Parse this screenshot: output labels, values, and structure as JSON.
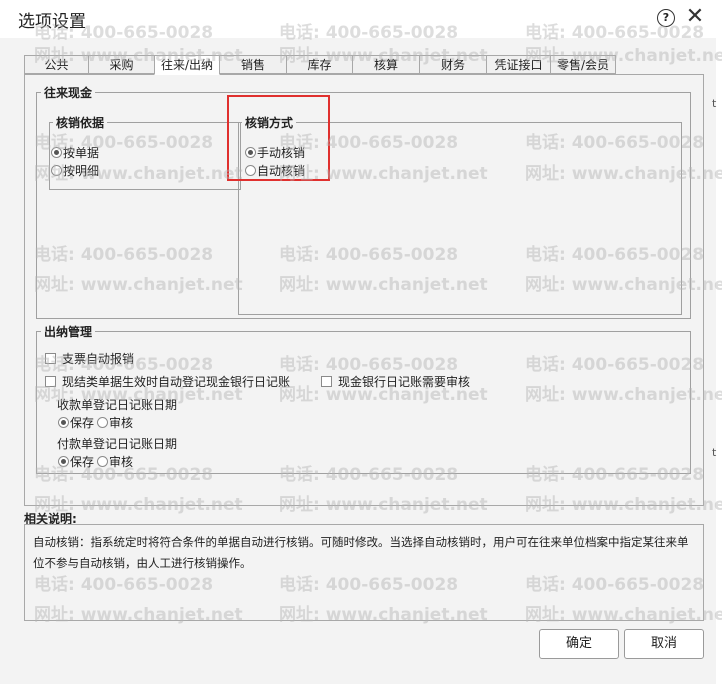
{
  "window": {
    "title": "选项设置",
    "help_glyph": "?",
    "close_glyph": "✕"
  },
  "tabs": [
    {
      "label": "公共"
    },
    {
      "label": "采购"
    },
    {
      "label": "往来/出纳"
    },
    {
      "label": "销售"
    },
    {
      "label": "库存"
    },
    {
      "label": "核算"
    },
    {
      "label": "财务"
    },
    {
      "label": "凭证接口"
    },
    {
      "label": "零售/会员"
    }
  ],
  "wanglai": {
    "title": "往来现金",
    "basis": {
      "title": "核销依据",
      "options": [
        {
          "label": "按单据",
          "selected": true
        },
        {
          "label": "按明细",
          "selected": false
        }
      ]
    },
    "method": {
      "title": "核销方式",
      "options": [
        {
          "label": "手动核销",
          "selected": true
        },
        {
          "label": "自动核销",
          "selected": false
        }
      ]
    }
  },
  "chuna": {
    "title": "出纳管理",
    "check1": {
      "label": "支票自动报销",
      "checked": false
    },
    "check2": {
      "label": "现结类单据生效时自动登记现金银行日记账",
      "checked": false
    },
    "check3": {
      "label": "现金银行日记账需要审核",
      "checked": false
    },
    "receipt": {
      "label": "收款单登记日记账日期",
      "options": [
        {
          "label": "保存",
          "selected": true
        },
        {
          "label": "审核",
          "selected": false
        }
      ]
    },
    "payment": {
      "label": "付款单登记日记账日期",
      "options": [
        {
          "label": "保存",
          "selected": true
        },
        {
          "label": "审核",
          "selected": false
        }
      ]
    }
  },
  "description": {
    "title": "相关说明:",
    "text": "自动核销：指系统定时将符合条件的单据自动进行核销。可随时修改。当选择自动核销时，用户可在往来单位档案中指定某往来单位不参与自动核销，由人工进行核销操作。"
  },
  "buttons": {
    "ok": "确定",
    "cancel": "取消"
  },
  "watermark": {
    "phone": "电话: 400-665-0028",
    "site": "网址: www.chanjet.net"
  },
  "edge_chars": [
    "t",
    "t"
  ],
  "colors": {
    "highlight": "#e0302e",
    "background": "#f3f3f3"
  }
}
